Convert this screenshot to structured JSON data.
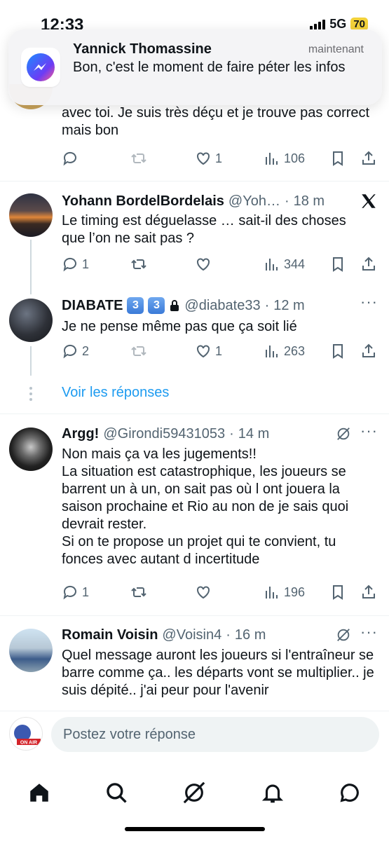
{
  "status_bar": {
    "time": "12:33",
    "network": "5G",
    "battery": "70"
  },
  "notification": {
    "sender": "Yannick Thomassine",
    "time": "maintenant",
    "message": "Bon, c'est le moment de faire péter les infos"
  },
  "tweets": [
    {
      "text": "avec toi. Je suis très déçu et je trouve pas correct mais bon",
      "replies": "",
      "retweets": "",
      "likes": "1",
      "views": "106"
    },
    {
      "name": "Yohann BordelBordelais",
      "handle": "@Yoh…",
      "time": "18 m",
      "text": "Le timing est déguelasse … sait-il des choses que l’on ne sait pas ?",
      "replies": "1",
      "retweets": "",
      "likes": "",
      "views": "344"
    },
    {
      "name": "DIABATE",
      "badges": [
        "3",
        "3"
      ],
      "handle": "@diabate33",
      "time": "12 m",
      "text": "Je ne pense même pas que ça soit lié",
      "replies": "2",
      "retweets": "",
      "likes": "1",
      "views": "263"
    },
    {
      "name": "Argg!",
      "handle": "@Girondi59431053",
      "time": "14 m",
      "text": "Non mais ça va les jugements!!\nLa situation est catastrophique, les joueurs se barrent un à un, on sait pas où l ont jouera la saison prochaine et Rio au non de je sais quoi devrait rester.\n Si on te propose un projet qui te convient, tu fonces avec autant d incertitude",
      "replies": "1",
      "retweets": "",
      "likes": "",
      "views": "196"
    },
    {
      "name": "Romain Voisin",
      "handle": "@Voisin4",
      "time": "16 m",
      "text": "Quel message auront les joueurs si l'entraîneur se barre comme ça.. les départs vont se multiplier.. je suis dépité.. j'ai peur pour l'avenir"
    }
  ],
  "show_replies_link": "Voir les réponses",
  "reply_bar": {
    "placeholder": "Postez votre réponse",
    "avatar_text": "ON AIR"
  },
  "tabs": [
    "home",
    "search",
    "grok",
    "notifications",
    "messages"
  ],
  "colors": {
    "accent": "#1d9bf0",
    "muted": "#536471",
    "text": "#0f1419"
  }
}
